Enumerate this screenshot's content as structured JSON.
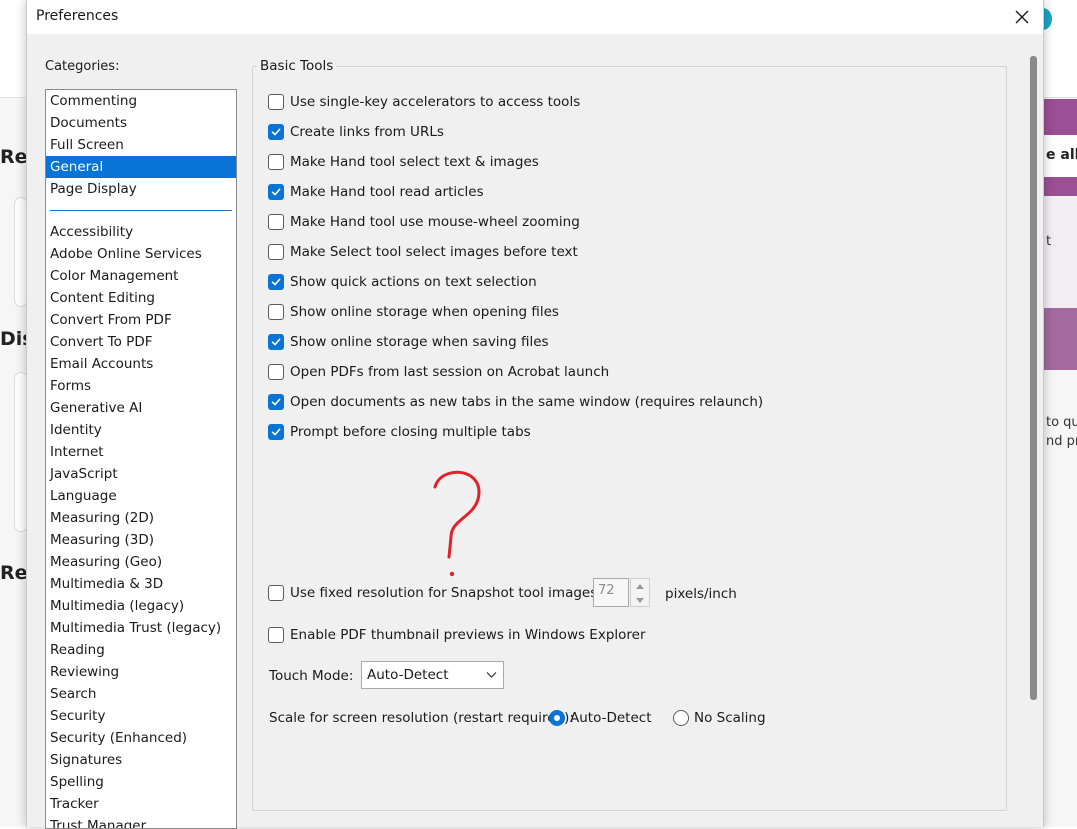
{
  "background": {
    "left_fragments": [
      "Rec",
      "Dis",
      "Rec"
    ],
    "right_fragments": [
      "e all t",
      "t",
      "to qu",
      "nd pre"
    ]
  },
  "dialog": {
    "title": "Preferences",
    "close_icon": "close-icon"
  },
  "categories": {
    "label": "Categories:",
    "top_items": [
      "Commenting",
      "Documents",
      "Full Screen",
      "General",
      "Page Display"
    ],
    "selected": "General",
    "items": [
      "Accessibility",
      "Adobe Online Services",
      "Color Management",
      "Content Editing",
      "Convert From PDF",
      "Convert To PDF",
      "Email Accounts",
      "Forms",
      "Generative AI",
      "Identity",
      "Internet",
      "JavaScript",
      "Language",
      "Measuring (2D)",
      "Measuring (3D)",
      "Measuring (Geo)",
      "Multimedia & 3D",
      "Multimedia (legacy)",
      "Multimedia Trust (legacy)",
      "Reading",
      "Reviewing",
      "Search",
      "Security",
      "Security (Enhanced)",
      "Signatures",
      "Spelling",
      "Tracker",
      "Trust Manager"
    ]
  },
  "basic_tools": {
    "title": "Basic Tools",
    "options": [
      {
        "label": "Use single-key accelerators to access tools",
        "checked": false
      },
      {
        "label": "Create links from URLs",
        "checked": true
      },
      {
        "label": "Make Hand tool select text & images",
        "checked": false
      },
      {
        "label": "Make Hand tool read articles",
        "checked": true
      },
      {
        "label": "Make Hand tool use mouse-wheel zooming",
        "checked": false
      },
      {
        "label": "Make Select tool select images before text",
        "checked": false
      },
      {
        "label": "Show quick actions on text selection",
        "checked": true
      },
      {
        "label": "Show online storage when opening files",
        "checked": false
      },
      {
        "label": "Show online storage when saving files",
        "checked": true
      },
      {
        "label": "Open PDFs from last session on Acrobat launch",
        "checked": false
      },
      {
        "label": "Open documents as new tabs in the same window (requires relaunch)",
        "checked": true
      },
      {
        "label": "Prompt before closing multiple tabs",
        "checked": true
      }
    ],
    "snapshot": {
      "label": "Use fixed resolution for Snapshot tool images:",
      "checked": false,
      "value": "72",
      "unit": "pixels/inch"
    },
    "thumbnail": {
      "label": "Enable PDF thumbnail previews in Windows Explorer",
      "checked": false
    },
    "touch_mode": {
      "label": "Touch Mode:",
      "value": "Auto-Detect"
    },
    "scale": {
      "label": "Scale for screen resolution (restart required):",
      "options": [
        {
          "label": "Auto-Detect",
          "selected": true
        },
        {
          "label": "No Scaling",
          "selected": false
        }
      ]
    }
  },
  "colors": {
    "accent": "#0a74d6",
    "annotation": "#e0202a"
  }
}
